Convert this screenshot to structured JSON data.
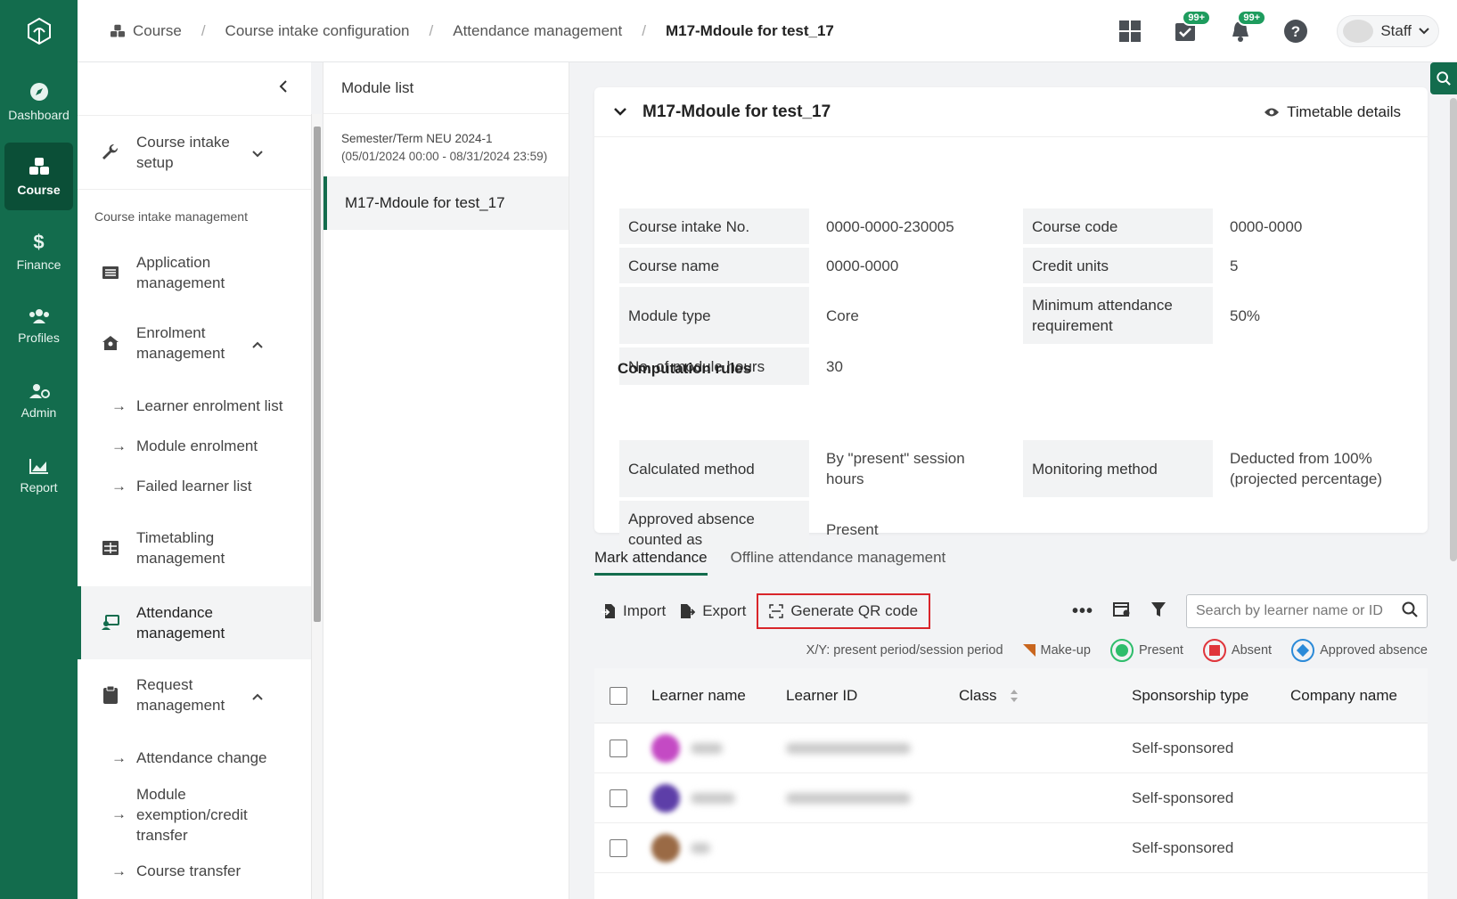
{
  "rail": {
    "items": [
      {
        "label": "Dashboard",
        "icon": "compass-icon"
      },
      {
        "label": "Course",
        "icon": "cubes-icon",
        "active": true
      },
      {
        "label": "Finance",
        "icon": "dollar-icon"
      },
      {
        "label": "Profiles",
        "icon": "users-icon"
      },
      {
        "label": "Admin",
        "icon": "user-gear-icon"
      },
      {
        "label": "Report",
        "icon": "chart-icon"
      }
    ]
  },
  "header": {
    "breadcrumb": [
      "Course",
      "Course intake configuration",
      "Attendance management",
      "M17-Mdoule for test_17"
    ],
    "tasks_badge": "99+",
    "notifications_badge": "99+",
    "user": "Staff"
  },
  "sidemenu": {
    "course_intake_setup": "Course intake setup",
    "section_title": "Course intake management",
    "application": "Application management",
    "enrolment": "Enrolment management",
    "enrolment_sub": [
      "Learner enrolment list",
      "Module enrolment",
      "Failed learner list"
    ],
    "timetabling": "Timetabling management",
    "attendance": "Attendance management",
    "request": "Request management",
    "request_sub": [
      "Attendance change",
      "Module exemption/credit transfer",
      "Course transfer"
    ]
  },
  "module_list": {
    "title": "Module list",
    "semester": "Semester/Term NEU 2024-1",
    "semester_range": "(05/01/2024 00:00 - 08/31/2024 23:59)",
    "selected": "M17-Mdoule for test_17"
  },
  "detail": {
    "title": "M17-Mdoule for test_17",
    "timetable_link": "Timetable details",
    "fields": {
      "course_intake_no_label": "Course intake No.",
      "course_intake_no": "0000-0000-230005",
      "course_code_label": "Course code",
      "course_code": "0000-0000",
      "course_name_label": "Course name",
      "course_name": "0000-0000",
      "credit_units_label": "Credit units",
      "credit_units": "5",
      "module_type_label": "Module type",
      "module_type": "Core",
      "min_attendance_label": "Minimum attendance requirement",
      "min_attendance": "50%",
      "module_hours_label": "No. of module hours",
      "module_hours": "30"
    },
    "computation_title": "Computation rules",
    "rules": {
      "calc_label": "Calculated method",
      "calc": "By \"present\" session hours",
      "monitor_label": "Monitoring method",
      "monitor": "Deducted from 100% (projected percentage)",
      "approved_label": "Approved absence counted as",
      "approved": "Present"
    }
  },
  "tabs": [
    "Mark attendance",
    "Offline attendance management"
  ],
  "toolbar": {
    "import": "Import",
    "export": "Export",
    "generate_qr": "Generate QR code",
    "search_placeholder": "Search by learner name or ID"
  },
  "legend": {
    "xy": "X/Y: present period/session period",
    "makeup": "Make-up",
    "present": "Present",
    "absent": "Absent",
    "approved": "Approved absence"
  },
  "colors": {
    "brand": "#136c4d",
    "present": "#2ebd6b",
    "absent": "#e0353b",
    "approved": "#2b8ad8",
    "makeup": "#c9661e"
  },
  "table": {
    "columns": [
      "Learner name",
      "Learner ID",
      "Class",
      "Sponsorship type",
      "Company name"
    ],
    "rows": [
      {
        "sponsorship": "Self-sponsored"
      },
      {
        "sponsorship": "Self-sponsored"
      },
      {
        "sponsorship": "Self-sponsored"
      }
    ]
  }
}
